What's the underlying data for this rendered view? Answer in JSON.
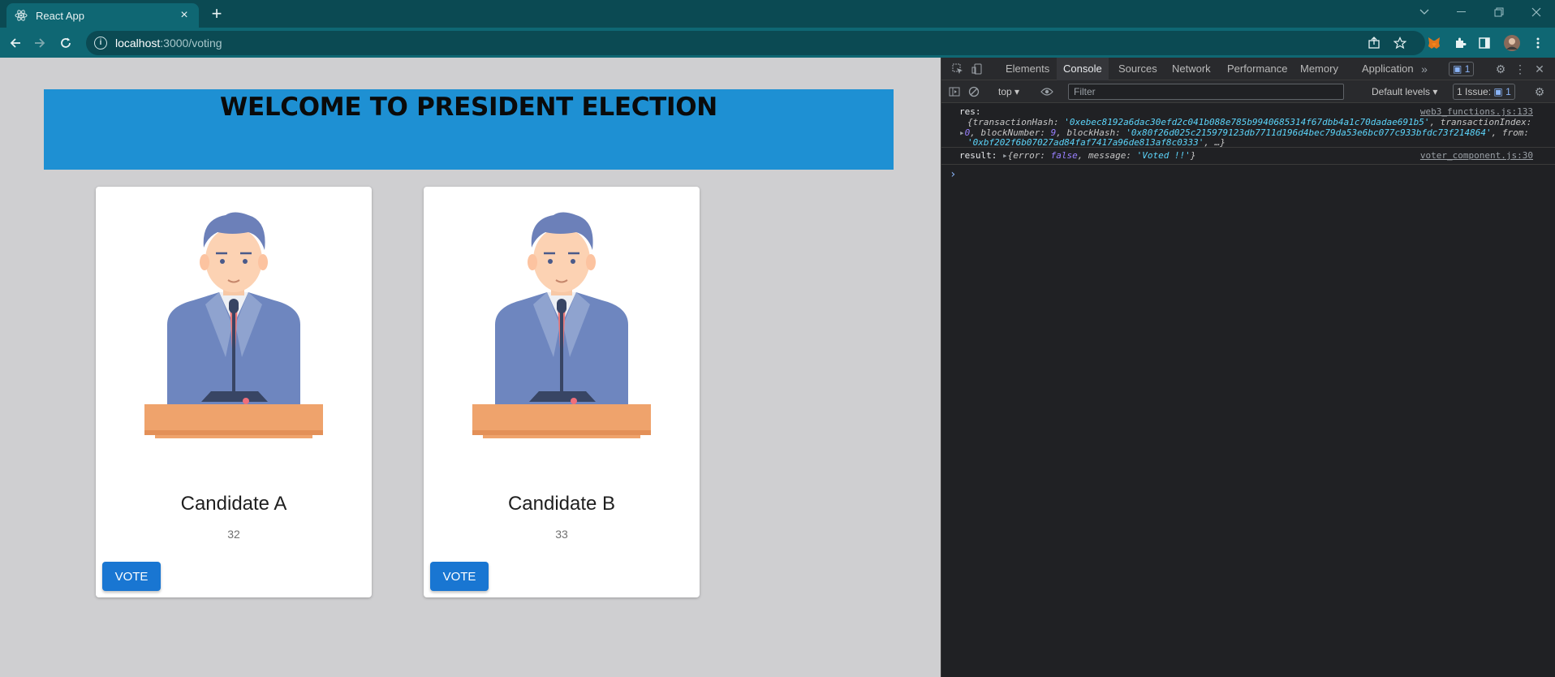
{
  "browser": {
    "tab_title": "React App",
    "url_host": "localhost",
    "url_path": ":3000/voting"
  },
  "page": {
    "heading": "WELCOME TO PRESIDENT ELECTION",
    "candidates": [
      {
        "name": "Candidate A",
        "votes": "32",
        "button": "VOTE"
      },
      {
        "name": "Candidate B",
        "votes": "33",
        "button": "VOTE"
      }
    ]
  },
  "devtools": {
    "tabs": [
      "Elements",
      "Console",
      "Sources",
      "Network",
      "Performance",
      "Memory",
      "Application"
    ],
    "active_tab": "Console",
    "messages_badge": "1",
    "context": "top",
    "filter_placeholder": "Filter",
    "levels": "Default levels",
    "issues": "1 Issue:",
    "issues_count": "1",
    "logs": [
      {
        "label": "res:",
        "source": "web3_functions.js:133",
        "transactionHash": "'0xebec8192a6dac30efd2c041b088e785b9940685314f67dbb4a1c70dadae691b5'",
        "transactionIndex": "0",
        "blockNumber": "9",
        "blockHash": "'0x80f26d025c215979123db7711d196d4bec79da53e6bc077c933bfdc73f214864'",
        "from": "'0xbf202f6b07027ad84faf7417a96de813af8c0333'",
        "tail": ", …}"
      },
      {
        "label": "result:",
        "source": "voter_component.js:30",
        "error": "false",
        "message": "'Voted !!'"
      }
    ]
  },
  "colors": {
    "tab_strip": "#0b4a53",
    "toolbar": "#0f6773",
    "banner": "#1e90d3",
    "vote_button": "#1976d2",
    "page_bg": "#cfcfd1",
    "devtools_bg": "#202124"
  }
}
